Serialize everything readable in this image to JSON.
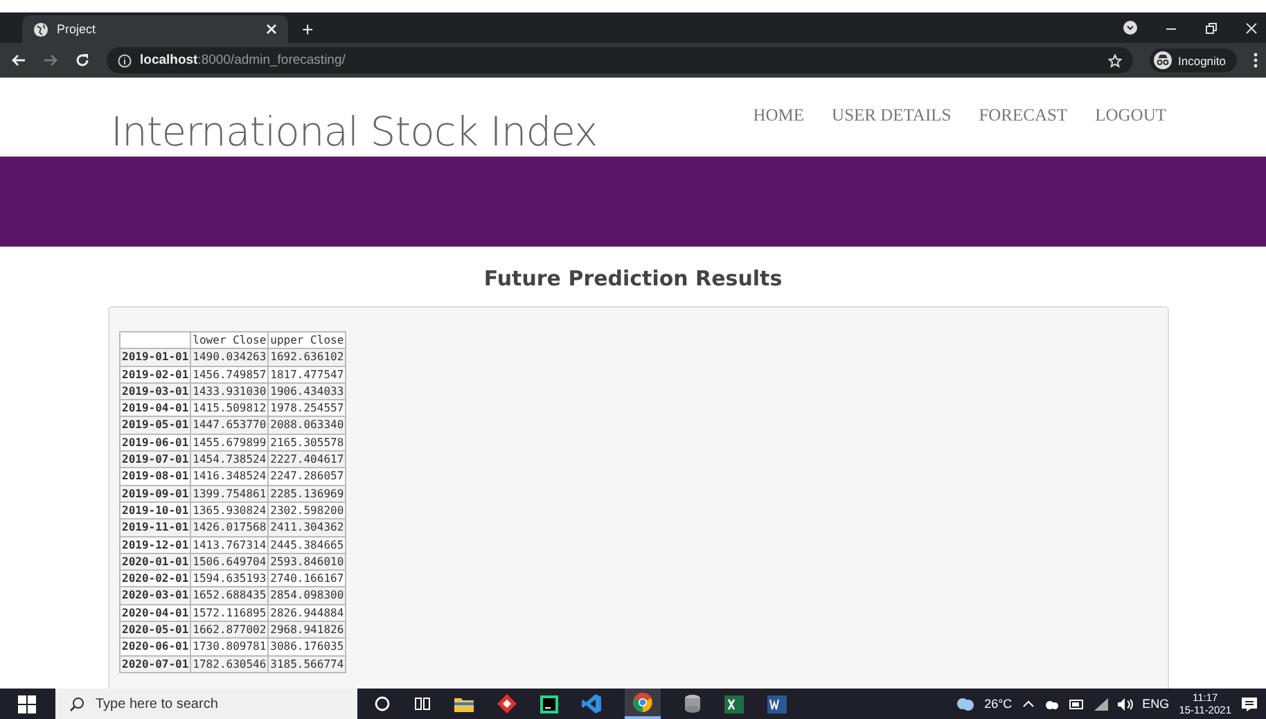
{
  "browser": {
    "tab_title": "Project",
    "new_tab": "+",
    "url_host": "localhost",
    "url_path": ":8000/admin_forecasting/",
    "profile": "Incognito"
  },
  "site": {
    "title": "International Stock Index",
    "nav": [
      {
        "label": "HOME"
      },
      {
        "label": "USER DETAILS"
      },
      {
        "label": "FORECAST"
      },
      {
        "label": "LOGOUT"
      }
    ]
  },
  "heading": "Future Prediction Results",
  "table": {
    "columns": [
      "",
      "lower Close",
      "upper Close"
    ],
    "rows": [
      [
        "2019-01-01",
        "1490.034263",
        "1692.636102"
      ],
      [
        "2019-02-01",
        "1456.749857",
        "1817.477547"
      ],
      [
        "2019-03-01",
        "1433.931030",
        "1906.434033"
      ],
      [
        "2019-04-01",
        "1415.509812",
        "1978.254557"
      ],
      [
        "2019-05-01",
        "1447.653770",
        "2088.063340"
      ],
      [
        "2019-06-01",
        "1455.679899",
        "2165.305578"
      ],
      [
        "2019-07-01",
        "1454.738524",
        "2227.404617"
      ],
      [
        "2019-08-01",
        "1416.348524",
        "2247.286057"
      ],
      [
        "2019-09-01",
        "1399.754861",
        "2285.136969"
      ],
      [
        "2019-10-01",
        "1365.930824",
        "2302.598200"
      ],
      [
        "2019-11-01",
        "1426.017568",
        "2411.304362"
      ],
      [
        "2019-12-01",
        "1413.767314",
        "2445.384665"
      ],
      [
        "2020-01-01",
        "1506.649704",
        "2593.846010"
      ],
      [
        "2020-02-01",
        "1594.635193",
        "2740.166167"
      ],
      [
        "2020-03-01",
        "1652.688435",
        "2854.098300"
      ],
      [
        "2020-04-01",
        "1572.116895",
        "2826.944884"
      ],
      [
        "2020-05-01",
        "1662.877002",
        "2968.941826"
      ],
      [
        "2020-06-01",
        "1730.809781",
        "3086.176035"
      ],
      [
        "2020-07-01",
        "1782.630546",
        "3185.566774"
      ]
    ]
  },
  "taskbar": {
    "search_placeholder": "Type here to search",
    "temperature": "26°C",
    "language": "ENG",
    "time": "11:17",
    "date": "15-11-2021"
  }
}
